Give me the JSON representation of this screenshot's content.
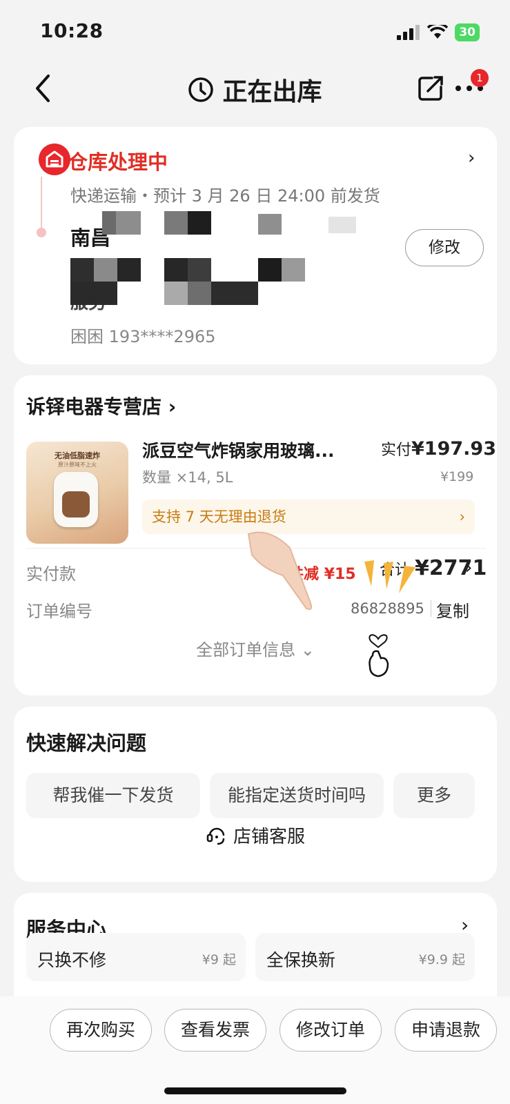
{
  "status_bar": {
    "time": "10:28",
    "battery": "30"
  },
  "nav": {
    "title": "正在出库",
    "badge_count": "1"
  },
  "warehouse": {
    "title": "仓库处理中",
    "subtitle": "快递运输・预计 3 月 26 日 24:00 前发货",
    "address_line1": "南昌",
    "address_line2": "",
    "address_line3": "服务",
    "contact": "困困   193****2965",
    "modify_label": "修改"
  },
  "order": {
    "store_name": "诉铎电器专营店",
    "product_image_text": "无油低脂速炸",
    "product_image_subtext": "原汁原味不上火",
    "product_title": "派豆空气炸锅家用玻璃...",
    "paid_label": "实付",
    "paid_value": "¥197.93",
    "quantity": "数量 ×14, 5L",
    "original_price": "¥199",
    "return_policy": "支持 7 天无理由退货",
    "payment_label": "实付款",
    "saving": "共减 ¥15",
    "total_label": "合计",
    "total_value": "¥2771",
    "order_no_label": "订单编号",
    "order_no": "86828895",
    "copy_label": "复制",
    "all_info_label": "全部订单信息"
  },
  "quick_solve": {
    "title": "快速解决问题",
    "chips": [
      "帮我催一下发货",
      "能指定送货时间吗",
      "更多"
    ],
    "customer_service": "店铺客服"
  },
  "service_center": {
    "title": "服务中心",
    "items": [
      {
        "name": "只换不修",
        "price": "¥9 起"
      },
      {
        "name": "全保换新",
        "price": "¥9.9 起"
      }
    ]
  },
  "bottom_bar": {
    "buttons": [
      "再次购买",
      "查看发票",
      "修改订单",
      "申请退款"
    ]
  },
  "colors": {
    "accent": "#e02e24",
    "return_text": "#c97b12",
    "battery": "#4cd964"
  }
}
